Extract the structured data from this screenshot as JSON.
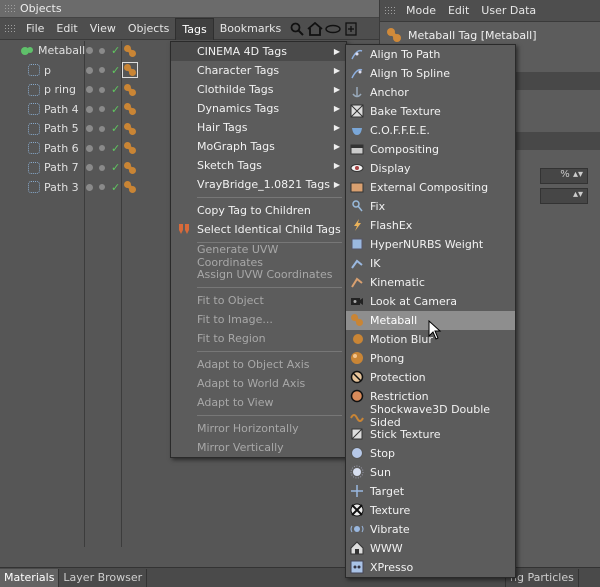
{
  "objects_panel": {
    "title": "Objects",
    "menu": [
      "File",
      "Edit",
      "View",
      "Objects",
      "Tags",
      "Bookmarks"
    ],
    "active_menu_index": 4,
    "objects": [
      "Metaball",
      "p",
      "p ring",
      "Path 4",
      "Path 5",
      "Path 6",
      "Path 7",
      "Path 3"
    ]
  },
  "attr_panel": {
    "menu": [
      "Mode",
      "Edit",
      "User Data"
    ],
    "title": "Metaball Tag [Metaball]",
    "field_suffix": "%"
  },
  "bottom_tabs": [
    "Materials",
    "Layer Browser",
    "ng Particles"
  ],
  "tags_menu": {
    "items": [
      {
        "label": "CINEMA 4D Tags",
        "submenu": true,
        "hl": true
      },
      {
        "label": "Character Tags",
        "submenu": true
      },
      {
        "label": "Clothilde Tags",
        "submenu": true
      },
      {
        "label": "Dynamics Tags",
        "submenu": true
      },
      {
        "label": "Hair Tags",
        "submenu": true
      },
      {
        "label": "MoGraph Tags",
        "submenu": true
      },
      {
        "label": "Sketch Tags",
        "submenu": true
      },
      {
        "label": "VrayBridge_1.0821 Tags",
        "submenu": true
      },
      {
        "sep": true
      },
      {
        "label": "Copy Tag to Children"
      },
      {
        "label": "Select Identical Child Tags",
        "icon": "select-tags-icon"
      },
      {
        "sep": true
      },
      {
        "label": "Generate UVW Coordinates",
        "disabled": true
      },
      {
        "label": "Assign UVW Coordinates",
        "disabled": true
      },
      {
        "sep": true
      },
      {
        "label": "Fit to Object",
        "disabled": true
      },
      {
        "label": "Fit to Image...",
        "disabled": true
      },
      {
        "label": "Fit to Region",
        "disabled": true
      },
      {
        "sep": true
      },
      {
        "label": "Adapt to Object Axis",
        "disabled": true
      },
      {
        "label": "Adapt to World Axis",
        "disabled": true
      },
      {
        "label": "Adapt to View",
        "disabled": true
      },
      {
        "sep": true
      },
      {
        "label": "Mirror Horizontally",
        "disabled": true
      },
      {
        "label": "Mirror Vertically",
        "disabled": true
      }
    ]
  },
  "c4d_menu": {
    "items": [
      {
        "label": "Align To Path",
        "icon": "align-path-icon"
      },
      {
        "label": "Align To Spline",
        "icon": "align-spline-icon"
      },
      {
        "label": "Anchor",
        "icon": "anchor-icon"
      },
      {
        "label": "Bake Texture",
        "icon": "bake-texture-icon"
      },
      {
        "label": "C.O.F.F.E.E.",
        "icon": "coffee-icon"
      },
      {
        "label": "Compositing",
        "icon": "compositing-icon"
      },
      {
        "label": "Display",
        "icon": "display-icon"
      },
      {
        "label": "External Compositing",
        "icon": "external-compositing-icon"
      },
      {
        "label": "Fix",
        "icon": "fix-icon"
      },
      {
        "label": "FlashEx",
        "icon": "flashex-icon"
      },
      {
        "label": "HyperNURBS Weight",
        "icon": "hypernurbs-icon"
      },
      {
        "label": "IK",
        "icon": "ik-icon"
      },
      {
        "label": "Kinematic",
        "icon": "kinematic-icon"
      },
      {
        "label": "Look at Camera",
        "icon": "camera-icon"
      },
      {
        "label": "Metaball",
        "icon": "metaball-icon",
        "hl": true
      },
      {
        "label": "Motion Blur",
        "icon": "motion-blur-icon"
      },
      {
        "label": "Phong",
        "icon": "phong-icon"
      },
      {
        "label": "Protection",
        "icon": "protection-icon"
      },
      {
        "label": "Restriction",
        "icon": "restriction-icon"
      },
      {
        "label": "Shockwave3D Double Sided",
        "icon": "shockwave-icon"
      },
      {
        "label": "Stick Texture",
        "icon": "stick-texture-icon"
      },
      {
        "label": "Stop",
        "icon": "stop-icon"
      },
      {
        "label": "Sun",
        "icon": "sun-icon"
      },
      {
        "label": "Target",
        "icon": "target-icon"
      },
      {
        "label": "Texture",
        "icon": "texture-icon"
      },
      {
        "label": "Vibrate",
        "icon": "vibrate-icon"
      },
      {
        "label": "WWW",
        "icon": "www-icon"
      },
      {
        "label": "XPresso",
        "icon": "xpresso-icon"
      }
    ]
  }
}
